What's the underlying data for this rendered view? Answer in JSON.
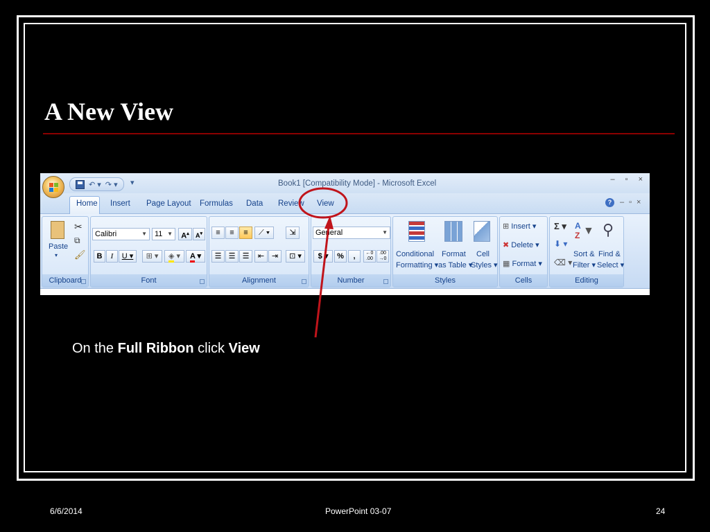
{
  "slide": {
    "title": "A New View",
    "caption": {
      "prefix": "On the ",
      "bold1": "Full Ribbon",
      "middle": " click ",
      "bold2": "View"
    }
  },
  "excel": {
    "window_title": "Book1  [Compatibility Mode] - Microsoft Excel",
    "tabs": [
      "Home",
      "Insert",
      "Page Layout",
      "Formulas",
      "Data",
      "Review",
      "View"
    ],
    "groups": {
      "clipboard": {
        "label": "Clipboard",
        "paste": "Paste"
      },
      "font": {
        "label": "Font",
        "font_name": "Calibri",
        "font_size": "11"
      },
      "alignment": {
        "label": "Alignment"
      },
      "number": {
        "label": "Number",
        "format": "General",
        "currency": "$",
        "percent": "%",
        "comma": ","
      },
      "styles": {
        "label": "Styles",
        "conditional_1": "Conditional",
        "conditional_2": "Formatting",
        "format_table_1": "Format",
        "format_table_2": "as Table",
        "cell_styles_1": "Cell",
        "cell_styles_2": "Styles"
      },
      "cells": {
        "label": "Cells",
        "insert": "Insert",
        "delete": "Delete",
        "format": "Format"
      },
      "editing": {
        "label": "Editing",
        "sort_1": "Sort &",
        "sort_2": "Filter",
        "find_1": "Find &",
        "find_2": "Select"
      }
    }
  },
  "footer": {
    "date": "6/6/2014",
    "center": "PowerPoint 03-07",
    "page": "24"
  },
  "colors": {
    "background": "#000000",
    "title_rule": "#8b0000",
    "highlight_circle": "#c0141b",
    "ribbon_blue": "#d5e4f5"
  }
}
